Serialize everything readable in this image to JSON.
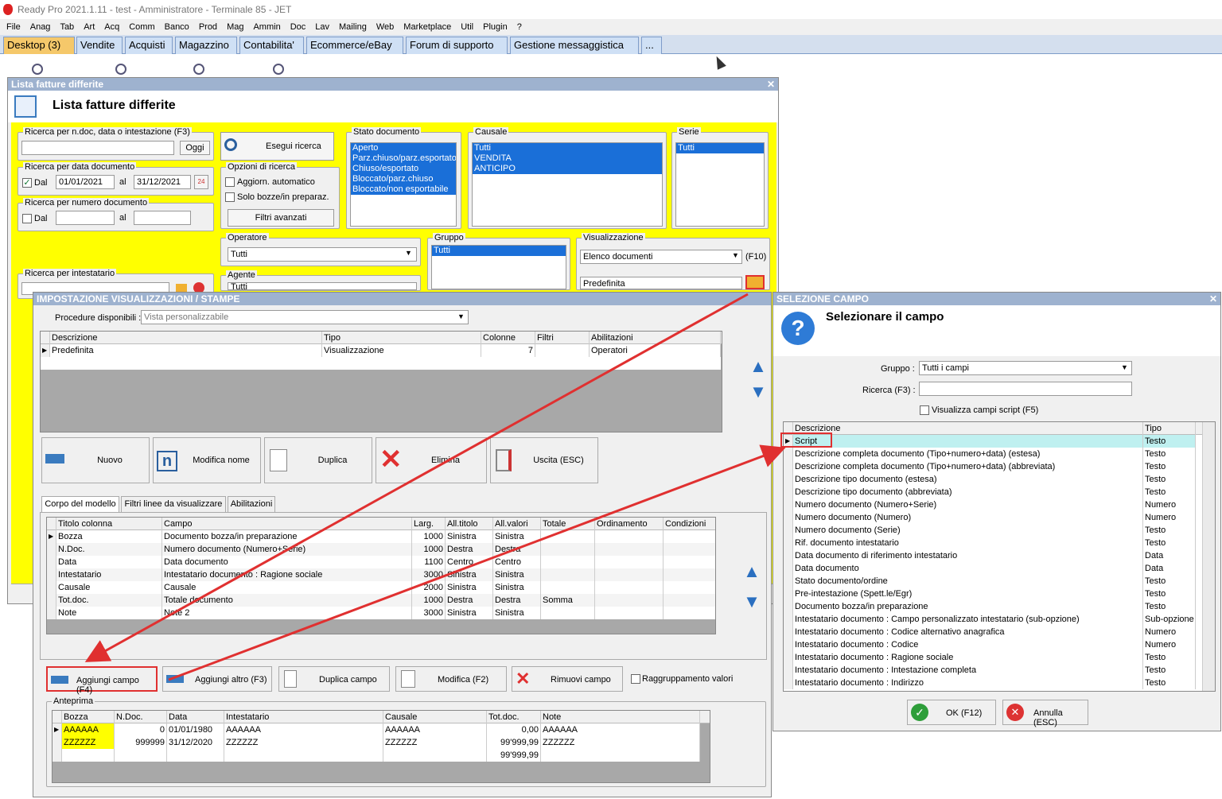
{
  "app": {
    "title": "Ready Pro 2021.1.11 - test - Amministratore - Terminale 85 - JET"
  },
  "menu": [
    "File",
    "Anag",
    "Tab",
    "Art",
    "Acq",
    "Comm",
    "Banco",
    "Prod",
    "Mag",
    "Ammin",
    "Doc",
    "Lav",
    "Mailing",
    "Web",
    "Marketplace",
    "Util",
    "Plugin",
    "?"
  ],
  "tabs": [
    "Desktop (3)",
    "Vendite",
    "Acquisti",
    "Magazzino",
    "Contabilita'",
    "Ecommerce/eBay",
    "Forum di supporto",
    "Gestione messaggistica",
    "..."
  ],
  "lista": {
    "window_title": "Lista fatture differite",
    "header": "Lista fatture differite",
    "ricerca_ndoc": {
      "label": "Ricerca per n.doc, data o intestazione (F3)",
      "value": "",
      "oggi": "Oggi"
    },
    "ricerca_data": {
      "label": "Ricerca per data documento",
      "dal": "Dal",
      "dal_value": "01/01/2021",
      "al": "al",
      "al_value": "31/12/2021"
    },
    "ricerca_numero": {
      "label": "Ricerca per numero documento",
      "dal": "Dal",
      "al": "al"
    },
    "ricerca_intestatario": {
      "label": "Ricerca per intestatario"
    },
    "esegui": "Esegui ricerca",
    "opzioni": {
      "label": "Opzioni di ricerca",
      "aggiorn": "Aggiorn. automatico",
      "solo_bozze": "Solo bozze/in preparaz.",
      "filtri": "Filtri avanzati"
    },
    "stato": {
      "label": "Stato documento",
      "items": [
        "Aperto",
        "Parz.chiuso/parz.esportato",
        "Chiuso/esportato",
        "Bloccato/parz.chiuso",
        "Bloccato/non esportabile"
      ]
    },
    "causale": {
      "label": "Causale",
      "items": [
        "Tutti",
        "VENDITA",
        "ANTICIPO"
      ]
    },
    "serie": {
      "label": "Serie",
      "items": [
        "Tutti"
      ]
    },
    "operatore": {
      "label": "Operatore",
      "value": "Tutti"
    },
    "agente": {
      "label": "Agente",
      "value": "Tutti"
    },
    "gruppo": {
      "label": "Gruppo",
      "items": [
        "Tutti"
      ]
    },
    "visualizzazione": {
      "label": "Visualizzazione",
      "value": "Elenco documenti",
      "f10": "(F10)",
      "value2": "Predefinita"
    }
  },
  "imp": {
    "title": "IMPOSTAZIONE VISUALIZZAZIONI / STAMPE",
    "procedure_label": "Procedure disponibili :",
    "procedure_value": "Vista personalizzabile",
    "top_cols": [
      "Descrizione",
      "Tipo",
      "Colonne",
      "Filtri",
      "Abilitazioni"
    ],
    "top_rows": [
      [
        "Predefinita",
        "Visualizzazione",
        "7",
        "",
        "Operatori"
      ]
    ],
    "buttons": [
      "Nuovo",
      "Modifica nome",
      "Duplica",
      "Elimina",
      "Uscita (ESC)"
    ],
    "subtabs": [
      "Corpo del modello",
      "Filtri linee da visualizzare",
      "Abilitazioni"
    ],
    "cols": [
      "Titolo colonna",
      "Campo",
      "Larg.",
      "All.titolo",
      "All.valori",
      "Totale",
      "Ordinamento",
      "Condizioni"
    ],
    "rows": [
      [
        "Bozza",
        "Documento bozza/in preparazione",
        "1000",
        "Sinistra",
        "Sinistra",
        "",
        ""
      ],
      [
        "N.Doc.",
        "Numero documento (Numero+Serie)",
        "1000",
        "Destra",
        "Destra",
        "",
        ""
      ],
      [
        "Data",
        "Data documento",
        "1100",
        "Centro",
        "Centro",
        "",
        ""
      ],
      [
        "Intestatario",
        "Intestatario documento : Ragione sociale",
        "3000",
        "Sinistra",
        "Sinistra",
        "",
        ""
      ],
      [
        "Causale",
        "Causale",
        "2000",
        "Sinistra",
        "Sinistra",
        "",
        ""
      ],
      [
        "Tot.doc.",
        "Totale documento",
        "1000",
        "Destra",
        "Destra",
        "Somma",
        ""
      ],
      [
        "Note",
        "Note 2",
        "3000",
        "Sinistra",
        "Sinistra",
        "",
        ""
      ]
    ],
    "bottom_buttons": [
      "Aggiungi campo (F4)",
      "Aggiungi altro (F3)",
      "Duplica campo",
      "Modifica (F2)",
      "Rimuovi campo"
    ],
    "raggruppamento": "Raggruppamento valori",
    "anteprima": {
      "label": "Anteprima",
      "cols": [
        "Bozza",
        "N.Doc.",
        "Data",
        "Intestatario",
        "Causale",
        "Tot.doc.",
        "Note"
      ],
      "rows": [
        [
          "AAAAAA",
          "0",
          "01/01/1980",
          "AAAAAA",
          "AAAAAA",
          "0,00",
          "AAAAAA"
        ],
        [
          "ZZZZZZ",
          "999999",
          "31/12/2020",
          "ZZZZZZ",
          "ZZZZZZ",
          "99'999,99",
          "ZZZZZZ"
        ],
        [
          "",
          "",
          "",
          "",
          "",
          "99'999,99",
          ""
        ]
      ]
    }
  },
  "sel": {
    "title": "SELEZIONE CAMPO",
    "header": "Selezionare il campo",
    "gruppo_label": "Gruppo :",
    "gruppo_value": "Tutti i campi",
    "ricerca_label": "Ricerca (F3) :",
    "script_chk": "Visualizza campi script (F5)",
    "cols": [
      "Descrizione",
      "Tipo"
    ],
    "rows": [
      [
        "Script",
        "Testo"
      ],
      [
        "Descrizione completa documento (Tipo+numero+data) (estesa)",
        "Testo"
      ],
      [
        "Descrizione completa documento (Tipo+numero+data) (abbreviata)",
        "Testo"
      ],
      [
        "Descrizione tipo documento (estesa)",
        "Testo"
      ],
      [
        "Descrizione tipo documento (abbreviata)",
        "Testo"
      ],
      [
        "Numero documento (Numero+Serie)",
        "Numero"
      ],
      [
        "Numero documento (Numero)",
        "Numero"
      ],
      [
        "Numero documento (Serie)",
        "Testo"
      ],
      [
        "Rif. documento intestatario",
        "Testo"
      ],
      [
        "Data documento di riferimento intestatario",
        "Data"
      ],
      [
        "Data documento",
        "Data"
      ],
      [
        "Stato documento/ordine",
        "Testo"
      ],
      [
        "Pre-intestazione (Spett.le/Egr)",
        "Testo"
      ],
      [
        "Documento bozza/in preparazione",
        "Testo"
      ],
      [
        "Intestatario documento : Campo personalizzato intestatario (sub-opzione)",
        "Sub-opzione"
      ],
      [
        "Intestatario documento : Codice alternativo anagrafica",
        "Numero"
      ],
      [
        "Intestatario documento : Codice",
        "Numero"
      ],
      [
        "Intestatario documento : Ragione sociale",
        "Testo"
      ],
      [
        "Intestatario documento : Intestazione completa",
        "Testo"
      ],
      [
        "Intestatario documento : Indirizzo",
        "Testo"
      ]
    ],
    "ok": "OK (F12)",
    "annulla": "Annulla (ESC)"
  },
  "colors": {
    "yellow": "#ffff00",
    "accent": "#1a6fd8",
    "red": "#e03030",
    "title_blue": "#9eb2cf"
  }
}
